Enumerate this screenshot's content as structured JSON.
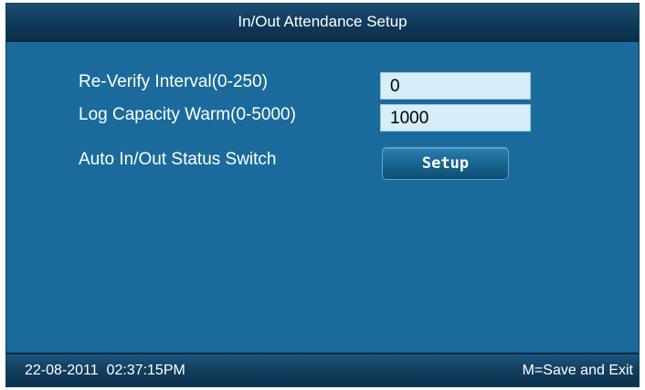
{
  "window": {
    "title": "In/Out Attendance Setup"
  },
  "settings": {
    "reverify": {
      "label": "Re-Verify Interval(0-250)",
      "value": "0"
    },
    "log_capacity": {
      "label": "Log Capacity Warm(0-5000)",
      "value": "1000"
    },
    "auto_status": {
      "label": "Auto In/Out Status Switch",
      "button_label": "Setup"
    }
  },
  "statusbar": {
    "datetime": "22-08-2011  02:37:15PM",
    "hint": "M=Save and Exit"
  },
  "colors": {
    "background": "#1a6b9c",
    "bar": "#103a59",
    "field": "#d6eef8",
    "text": "#ffffff"
  }
}
